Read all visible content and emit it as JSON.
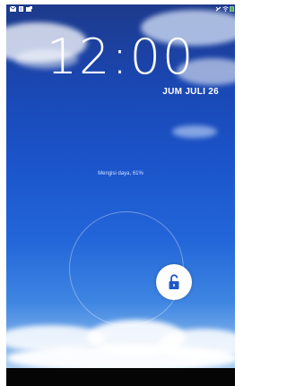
{
  "lockscreen": {
    "time": "12:00",
    "date": "JUM JULI 26",
    "charging_status": "Mengisi daya, 61%"
  },
  "statusbar": {
    "left_icons": [
      "mail-icon",
      "document-icon",
      "screenshot-icon"
    ],
    "right_icons": [
      "notification-icon",
      "wifi-icon",
      "battery-icon"
    ]
  },
  "colors": {
    "sky_top": "#1d3a8c",
    "sky_bottom": "#a9cdf0",
    "text": "#ffffff",
    "unlock_icon": "#1f57c8",
    "battery": "#4caf50"
  }
}
